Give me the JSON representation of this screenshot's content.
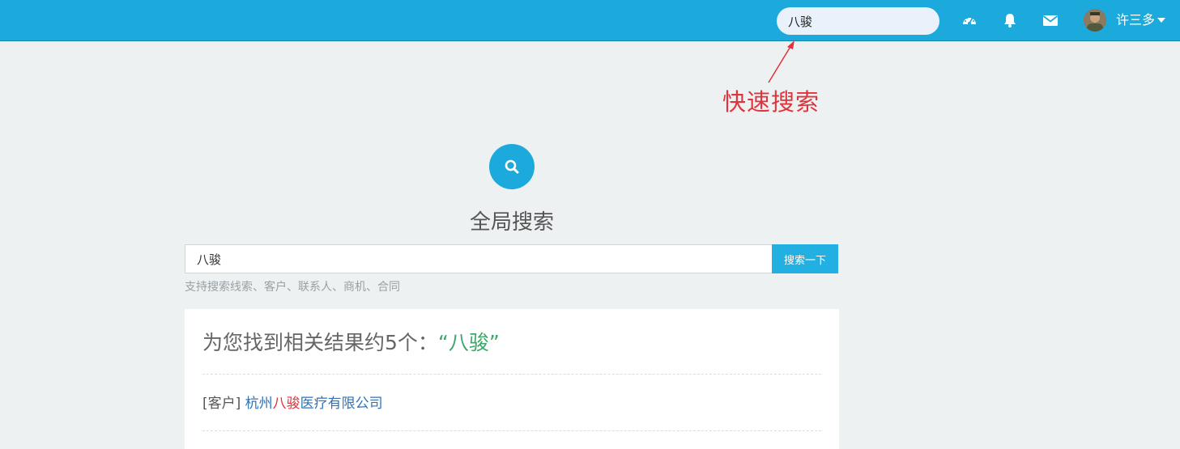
{
  "topbar": {
    "quick_search_value": "八骏",
    "icons": [
      "dashboard-icon",
      "bell-icon",
      "envelope-icon"
    ],
    "username": "许三多",
    "color": "#1ca9db"
  },
  "annotation": {
    "label": "快速搜索",
    "color": "#e0343c"
  },
  "search": {
    "title": "全局搜索",
    "value": "八骏",
    "button_label": "搜索一下",
    "hint": "支持搜索线索、客户、联系人、商机、合同"
  },
  "results": {
    "summary_prefix": "为您找到相关结果约5个：",
    "summary_term": "“八骏”",
    "items": [
      {
        "type": "[客户]",
        "name_before": "杭州",
        "name_highlight": "八骏",
        "name_after": "医疗有限公司"
      }
    ]
  }
}
